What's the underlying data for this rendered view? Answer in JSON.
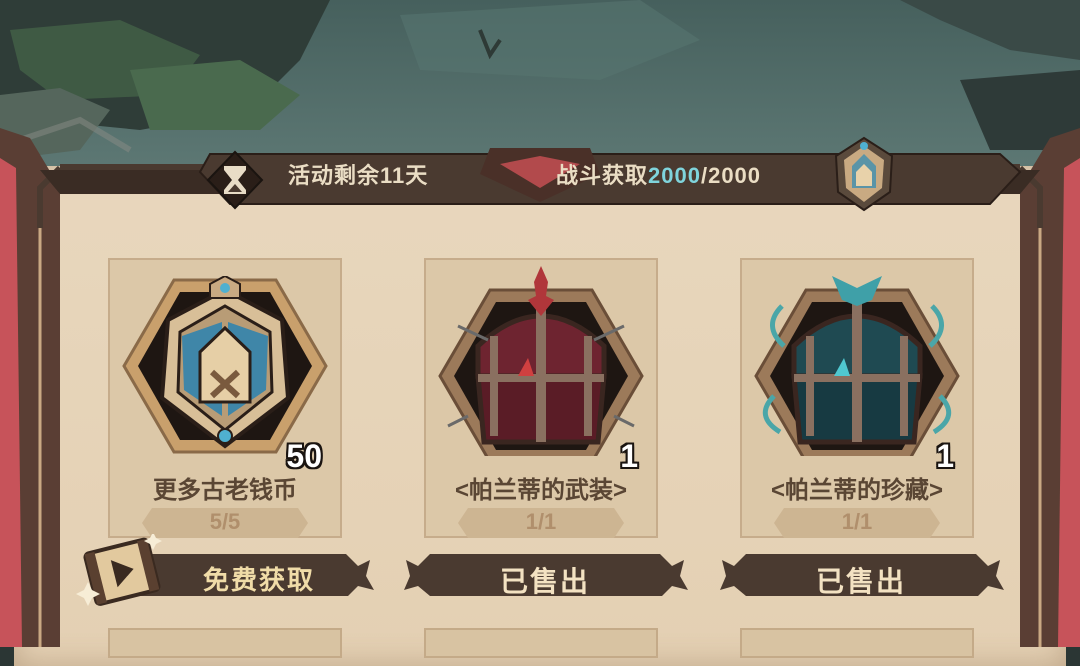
{
  "header": {
    "timer_icon": "hourglass-icon",
    "remaining_label": "活动剩余11天",
    "battle_label": "战斗获取",
    "battle_current": "2000",
    "battle_sep_max": "/2000",
    "currency_icon": "ancient-coin-icon"
  },
  "colors": {
    "highlight": "#7fd4dc",
    "panel": "#e6d3b8",
    "button": "#4a3a30"
  },
  "shop": {
    "items": [
      {
        "icon": "ancient-coin-icon",
        "count": "50",
        "name": "更多古老钱币",
        "stock": "5/5",
        "button": "免费获取",
        "button_icon": "video-ad-icon"
      },
      {
        "icon": "red-treasure-chest-icon",
        "count": "1",
        "name": "<帕兰蒂的武装>",
        "stock": "1/1",
        "button": "已售出"
      },
      {
        "icon": "teal-treasure-chest-icon",
        "count": "1",
        "name": "<帕兰蒂的珍藏>",
        "stock": "1/1",
        "button": "已售出"
      }
    ]
  }
}
